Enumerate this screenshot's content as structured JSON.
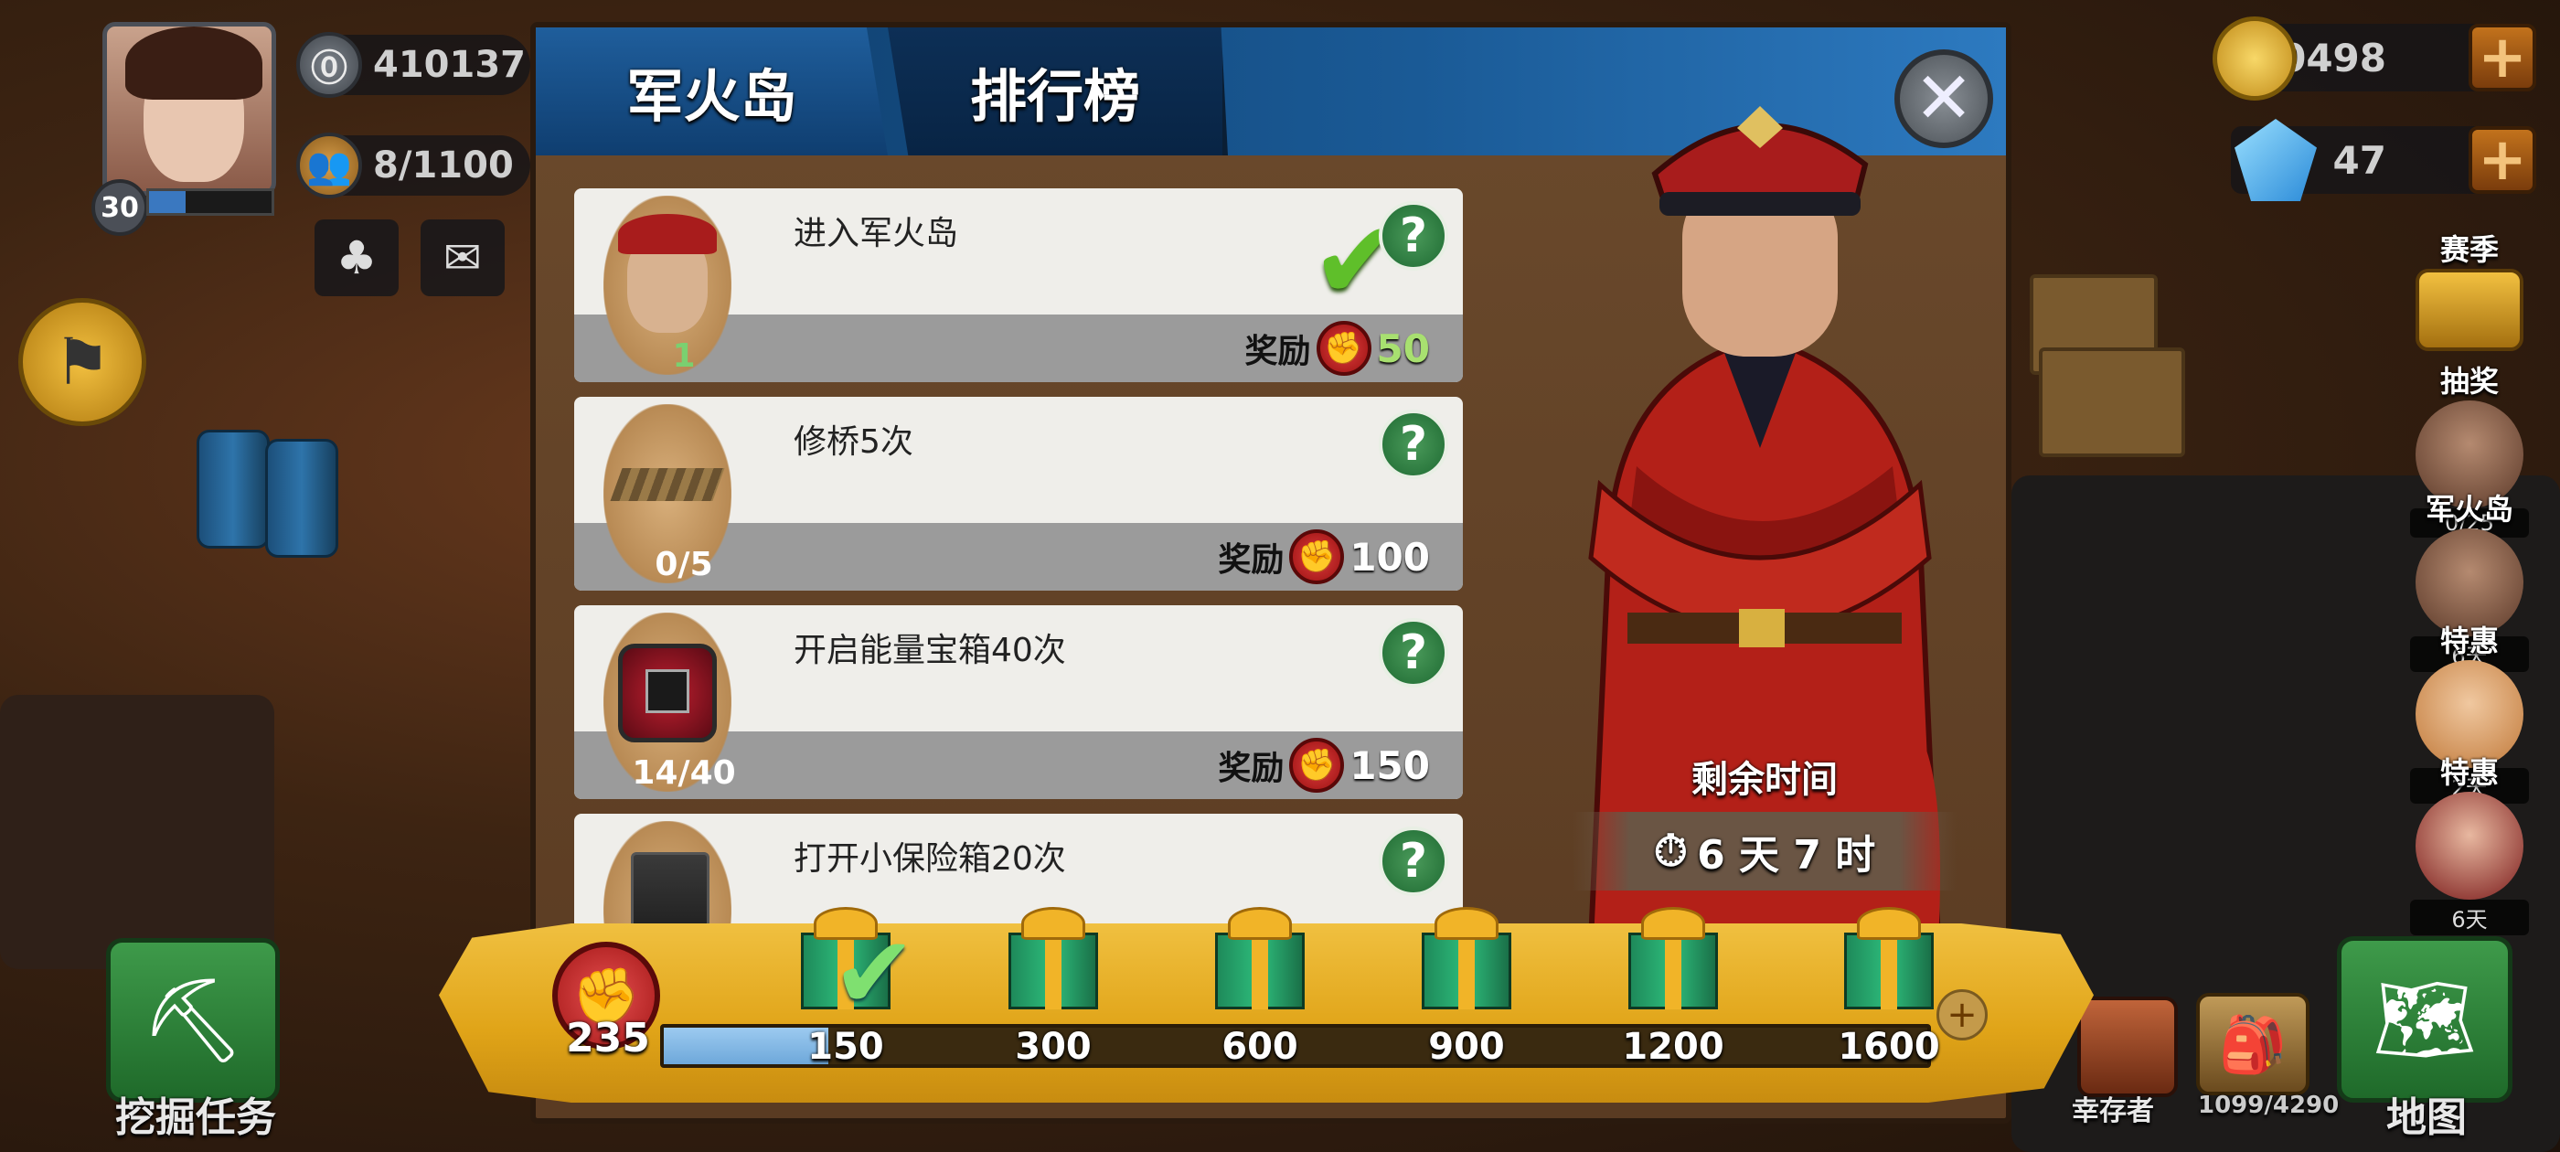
{
  "player": {
    "level": "30",
    "power": "410137",
    "population": "8/1100"
  },
  "currency": {
    "gold": "860498",
    "gems": "47"
  },
  "panel": {
    "tabs": [
      "军火岛",
      "排行榜"
    ],
    "close_icon": "close-icon",
    "quests": [
      {
        "title": "进入军火岛",
        "progress": "1",
        "reward_label": "奖励",
        "reward_value": "50",
        "completed": true,
        "icon": "commander-portrait-icon"
      },
      {
        "title": "修桥5次",
        "progress": "0/5",
        "reward_label": "奖励",
        "reward_value": "100",
        "completed": false,
        "icon": "bridge-planks-icon"
      },
      {
        "title": "开启能量宝箱40次",
        "progress": "14/40",
        "reward_label": "奖励",
        "reward_value": "150",
        "completed": false,
        "icon": "energy-chest-icon"
      },
      {
        "title": "打开小保险箱20次",
        "progress": "",
        "reward_label": "",
        "reward_value": "",
        "completed": false,
        "icon": "small-safe-icon"
      }
    ],
    "timer": {
      "title": "剩余时间",
      "value": "6 天 7 时"
    }
  },
  "progress": {
    "points": "235",
    "fraction": 0.13,
    "milestones": [
      {
        "value": "150",
        "claimed": true
      },
      {
        "value": "300",
        "claimed": false
      },
      {
        "value": "600",
        "claimed": false
      },
      {
        "value": "900",
        "claimed": false
      },
      {
        "value": "1200",
        "claimed": false
      },
      {
        "value": "1600",
        "claimed": false
      }
    ]
  },
  "sidebar": [
    {
      "label": "赛季",
      "caption": ""
    },
    {
      "label": "抽奖",
      "caption": "0/25"
    },
    {
      "label": "军火岛",
      "caption": "6天"
    },
    {
      "label": "特惠",
      "caption": "2天"
    },
    {
      "label": "特惠",
      "caption": "6天"
    }
  ],
  "bottom": {
    "dig_task": "挖掘任务",
    "survivors_label": "幸存者",
    "survivors_count": "1099/4290",
    "map": "地图"
  },
  "colors": {
    "tab_active": "#1f5e9c",
    "quest_check": "#5fbf2a",
    "reward_red": "#c41e1e",
    "scroll_gold": "#e0a418",
    "progress_fill": "#7eb6e4"
  }
}
